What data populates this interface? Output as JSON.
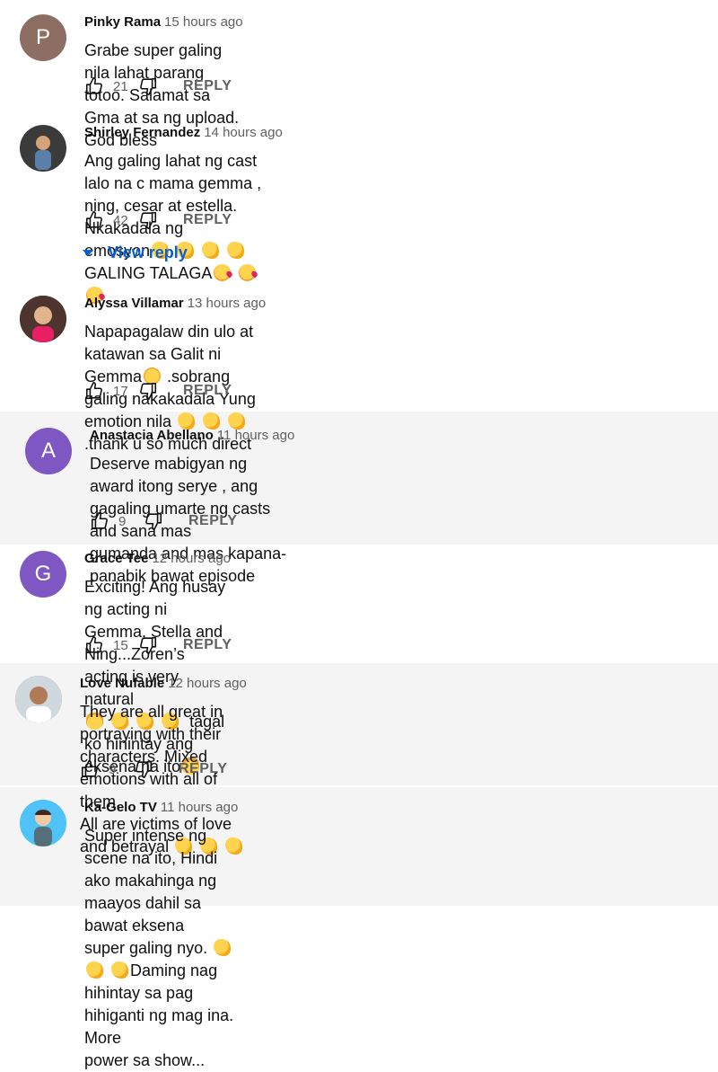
{
  "comments": [
    {
      "author": "Pinky Rama",
      "time": "15 hours ago",
      "avatar_letter": "P",
      "avatar_color": "#8d6e63",
      "text": "Grabe super galing nila lahat parang totoo. Salamat sa Gma at sa ng upload. God bless",
      "likes": "21",
      "reply": "REPLY"
    },
    {
      "author": "Shirley Fernandez",
      "time": "14 hours ago",
      "avatar_color": "#3b3b3b",
      "text_a": "Ang galing lahat ng cast lalo na c mama gemma , ning, cesar at estella. Nkakadala ng",
      "text_b": "emosyon",
      "text_c": "GALING TALAGA",
      "likes": "42",
      "reply": "REPLY",
      "view_reply": "View reply"
    },
    {
      "author": "Alyssa Villamar",
      "time": "13 hours ago",
      "avatar_color": "#6d4c41",
      "text_a": "Napapagalaw din ulo at katawan sa Galit ni Gemma",
      "text_b": ".sobrang galing nakakadala Yung",
      "text_c": "emotion nila",
      "text_d": ".thank u so much direct",
      "likes": "17",
      "reply": "REPLY"
    },
    {
      "author": "Anastacia Abellano",
      "time": "11 hours ago",
      "avatar_letter": "A",
      "avatar_color": "#7e57c2",
      "text": "Deserve mabigyan ng award itong serye , ang gagaling umarte ng casts and sana mas\ngumanda and mas kapana-panabik bawat episode",
      "likes": "9",
      "reply": "REPLY"
    },
    {
      "author": "Grace Tee",
      "time": "12 hours ago",
      "avatar_letter": "G",
      "avatar_color": "#7e57c2",
      "text_a": "Exciting! Ang husay ng acting ni Gemma, Stella and Ning...Zoren’s acting is very natural",
      "text_b": "tagal ko hinintay ang eksena na ito",
      "likes": "15",
      "reply": "REPLY"
    },
    {
      "author": "Love Nufable",
      "time": "12 hours ago",
      "avatar_color": "#a1887f",
      "text_a": "They are all great in portraying with their characters. Mixed emotions with all of them.",
      "text_b": "All are victims of love and betrayal",
      "likes": "9",
      "reply": "REPLY"
    },
    {
      "author": "Ka-Gelo TV",
      "time": "11 hours ago",
      "avatar_color": "#4fc3f7",
      "text_a": "Super intense ng scene na ito, Hindi ako makahinga ng maayos dahil sa bawat eksena",
      "text_b": "super galing nyo.",
      "text_c": "Daming nag hihintay sa pag hihiganti ng mag ina. More",
      "text_d": "power sa show..."
    }
  ],
  "colors": {
    "link": "#065fd4",
    "secondary": "#606060",
    "band": "#f4f4f4"
  },
  "icons": [
    "like-icon",
    "dislike-icon",
    "chevron-down-icon",
    "clap-emoji",
    "kiss-emoji",
    "laugh-emoji",
    "thumbs-up-emoji"
  ]
}
